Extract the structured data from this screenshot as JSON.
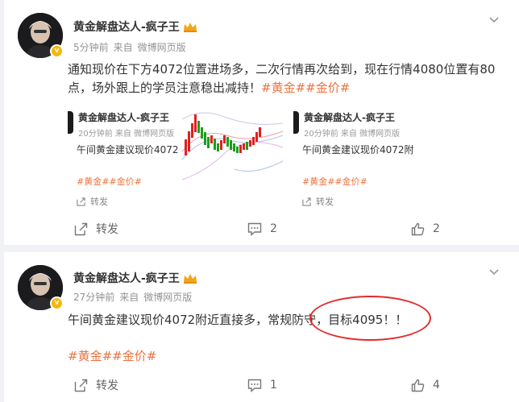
{
  "posts": [
    {
      "author": "黄金解盘达人-疯子王",
      "time": "5分钟前",
      "source_prefix": "来自",
      "source": "微博网页版",
      "text": "通知现价在下方4072位置进场多，二次行情再次给到，现在行情4080位置有80点，场外跟上的学员注意稳出减持！",
      "tags": "#黄金##金价#",
      "repost": {
        "author": "黄金解盘达人-疯子王",
        "meta": "20分钟前 来自 微博网页版",
        "text": "午间黄金建议现价4072附",
        "tags": "#黄金##金价#",
        "forward_label": "转发"
      },
      "forward_label": "转发",
      "comment_count": "2",
      "like_count": "2"
    },
    {
      "author": "黄金解盘达人-疯子王",
      "time": "27分钟前",
      "source_prefix": "来自",
      "source": "微博网页版",
      "text": "午间黄金建议现价4072附近直接多，常规防守，目标4095！！",
      "tags": "#黄金##金价#",
      "forward_label": "转发",
      "comment_count": "1",
      "like_count": "4"
    }
  ],
  "badge_letter": "v",
  "colors": {
    "tag": "#eb7340",
    "annotation": "#e22b2b",
    "verified": "#f6b60c"
  },
  "icons": [
    "more-chevron-icon",
    "forward-icon",
    "comment-icon",
    "like-icon",
    "crown-icon",
    "verified-badge-icon"
  ]
}
